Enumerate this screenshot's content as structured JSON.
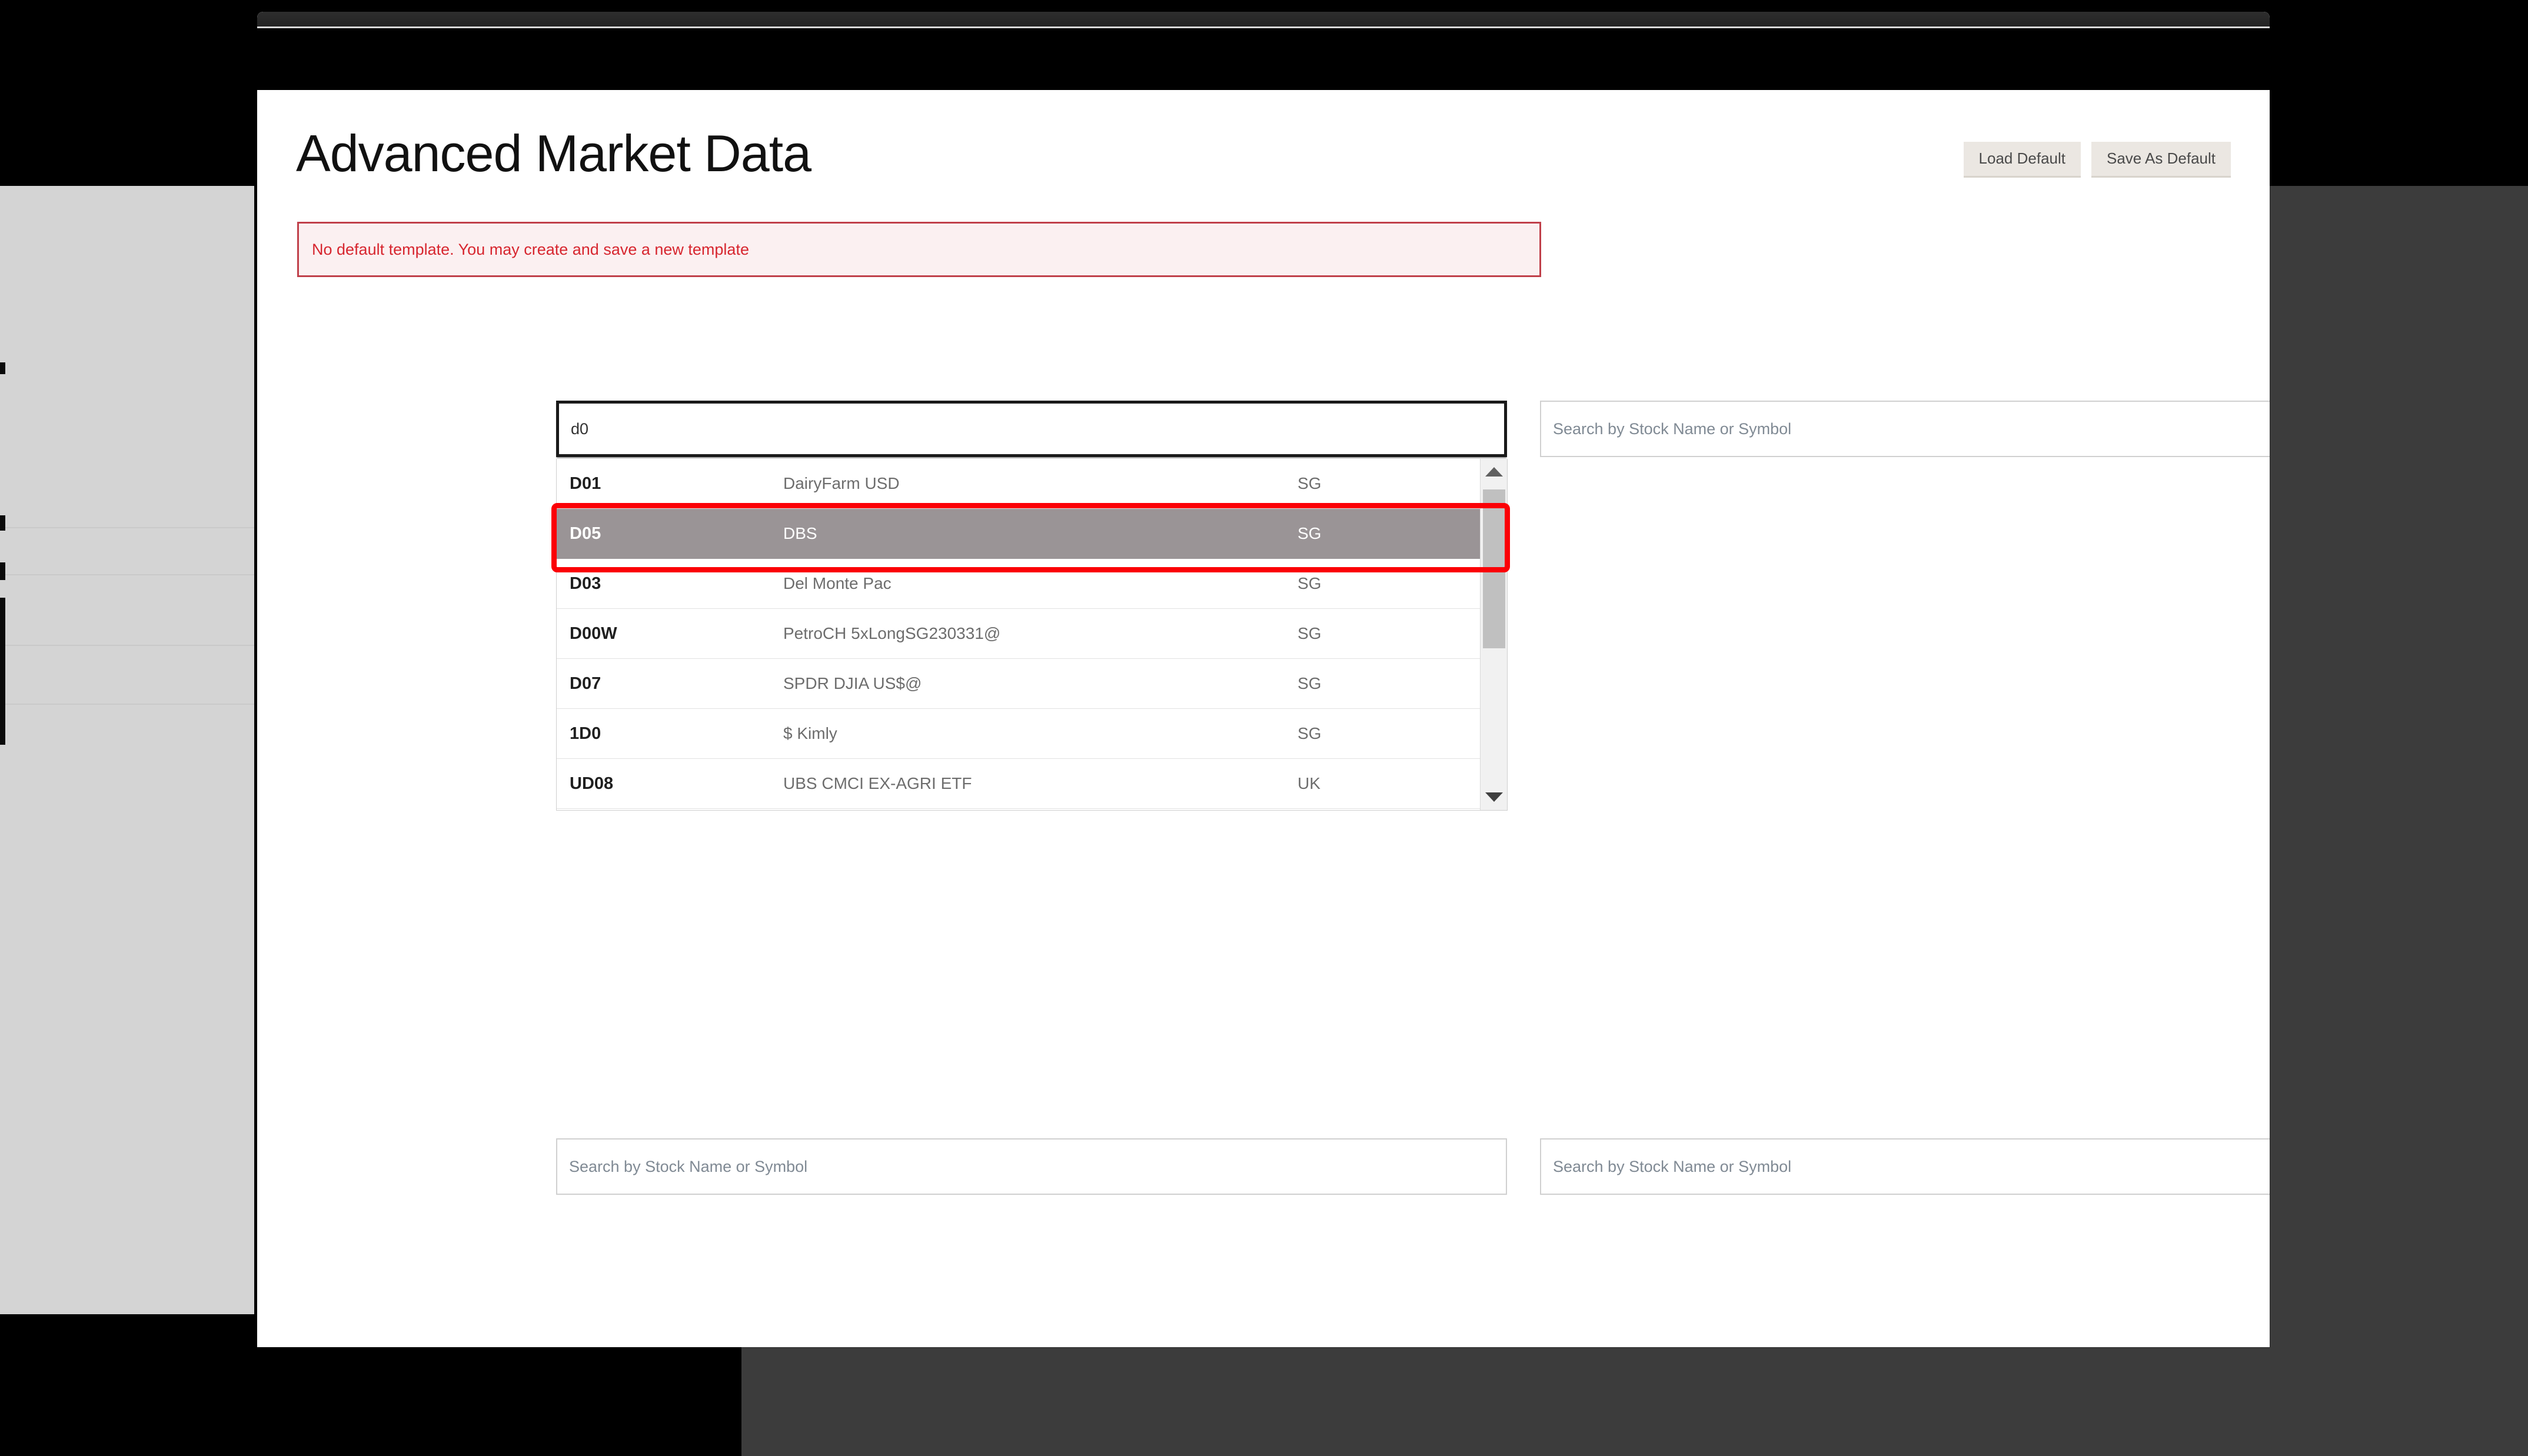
{
  "window": {
    "title": "Advanced Market Data"
  },
  "header": {
    "title": "Advanced Market Data",
    "buttons": [
      {
        "name": "load-default",
        "label": "Load Default"
      },
      {
        "name": "save-as-default",
        "label": "Save As Default"
      }
    ]
  },
  "alert": {
    "message": "No default template. You may create and save a new template",
    "text_color": "#d7262f",
    "bg_color": "#fbf0f1",
    "border_color": "#c0404a"
  },
  "search_fields": {
    "placeholder": "Search by Stock Name or Symbol",
    "top_left_value": "d0",
    "top_right_value": "",
    "bottom_left_value": "",
    "bottom_right_value": ""
  },
  "autocomplete": {
    "query": "d0",
    "selected_index": 1,
    "selected_color": "#9a9496",
    "annotation_color": "#fb0006",
    "rows": [
      {
        "symbol": "D01",
        "name": "DairyFarm USD",
        "market": "SG"
      },
      {
        "symbol": "D05",
        "name": "DBS",
        "market": "SG"
      },
      {
        "symbol": "D03",
        "name": "Del Monte Pac",
        "market": "SG"
      },
      {
        "symbol": "D00W",
        "name": "PetroCH 5xLongSG230331@",
        "market": "SG"
      },
      {
        "symbol": "D07",
        "name": "SPDR DJIA US$@",
        "market": "SG"
      },
      {
        "symbol": "1D0",
        "name": "$ Kimly",
        "market": "SG"
      },
      {
        "symbol": "UD08",
        "name": "UBS CMCI EX-AGRI ETF",
        "market": "UK"
      }
    ],
    "scrollbar": {
      "up_arrow": "triangle-up-icon",
      "down_arrow": "triangle-down-icon"
    }
  }
}
